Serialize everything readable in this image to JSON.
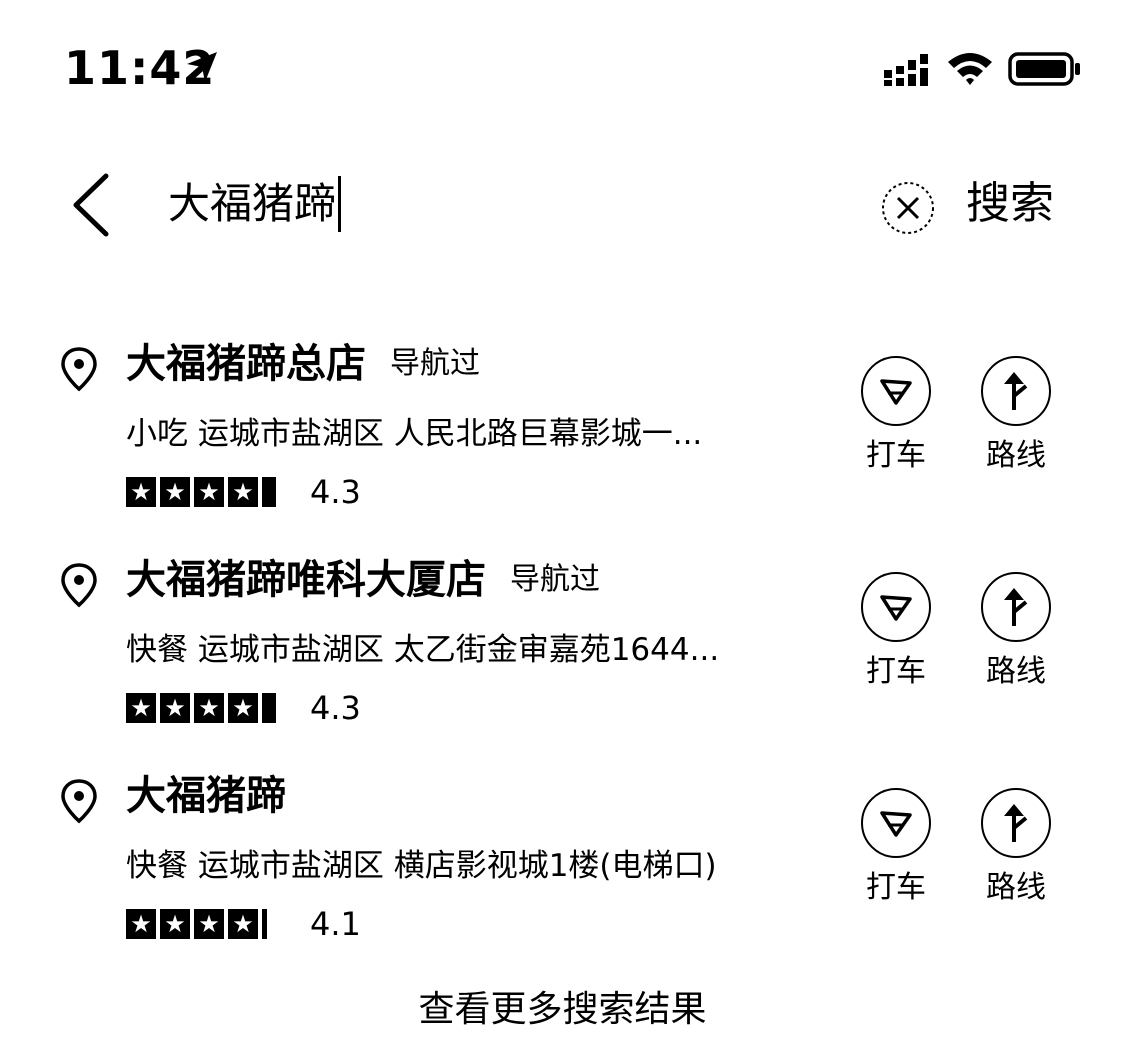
{
  "status_bar": {
    "time": "11:42",
    "icons": [
      "location-arrow-icon",
      "signal-icon",
      "wifi-icon",
      "battery-icon"
    ]
  },
  "search": {
    "query": "大福猪蹄",
    "button_label": "搜索",
    "icons": [
      "back-icon",
      "clear-icon"
    ]
  },
  "results": [
    {
      "name": "大福猪蹄总店",
      "badge": "导航过",
      "category": "小吃",
      "address": "运城市盐湖区 人民北路巨幕影城一...",
      "rating": "4.3",
      "stars_filled": 4.3,
      "actions": {
        "taxi": "打车",
        "route": "路线"
      }
    },
    {
      "name": "大福猪蹄唯科大厦店",
      "badge": "导航过",
      "category": "快餐",
      "address": "运城市盐湖区 太乙街金审嘉苑1644...",
      "rating": "4.3",
      "stars_filled": 4.3,
      "actions": {
        "taxi": "打车",
        "route": "路线"
      }
    },
    {
      "name": "大福猪蹄",
      "badge": "",
      "category": "快餐",
      "address": "运城市盐湖区 横店影视城1楼(电梯口)",
      "rating": "4.1",
      "stars_filled": 4.1,
      "actions": {
        "taxi": "打车",
        "route": "路线"
      }
    }
  ],
  "footer": {
    "more_label": "查看更多搜索结果"
  },
  "colors": {
    "text": "#000000",
    "background": "#ffffff"
  }
}
